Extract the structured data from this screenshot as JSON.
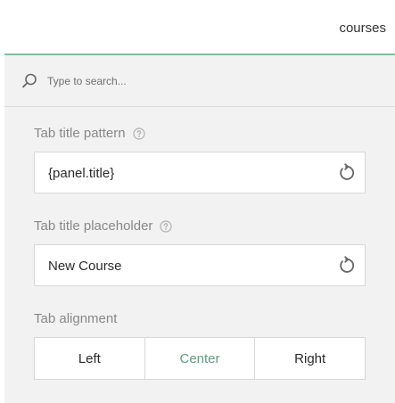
{
  "header": {
    "title": "courses"
  },
  "search": {
    "placeholder": "Type to search...",
    "icon": "search-icon"
  },
  "fields": {
    "title_pattern": {
      "label": "Tab title pattern",
      "value": "{panel.title}",
      "help_icon": "help-icon",
      "reset_icon": "reset-icon"
    },
    "title_placeholder": {
      "label": "Tab title placeholder",
      "value": "New Course",
      "help_icon": "help-icon",
      "reset_icon": "reset-icon"
    }
  },
  "alignment": {
    "label": "Tab alignment",
    "options": [
      "Left",
      "Center",
      "Right"
    ],
    "selected": "Center"
  },
  "colors": {
    "accent": "#7fbf9f",
    "active_text": "#5f9f84",
    "panel_bg": "#f2f2f2"
  }
}
